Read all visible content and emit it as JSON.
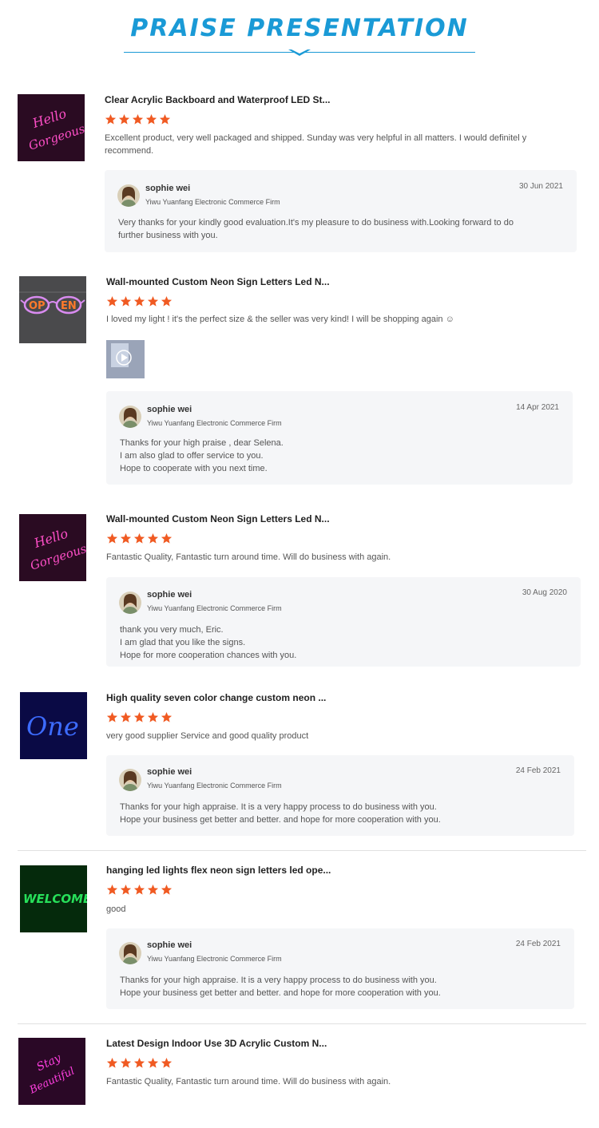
{
  "header": {
    "title": "PRAISE PRESENTATION"
  },
  "colors": {
    "accent": "#1a9ad6",
    "star": "#f05a22",
    "reply_bg": "#f5f6f8"
  },
  "reviews": [
    {
      "product_title": "Clear Acrylic Backboard and Waterproof LED St...",
      "rating": 5,
      "text": "Excellent product, very well packaged and shipped. Sunday was very helpful in all matters. I would definitel y recommend.",
      "reply": {
        "name": "sophie wei",
        "firm": "Yiwu Yuanfang Electronic Commerce Firm",
        "date": "30 Jun 2021",
        "lines": [
          "Very thanks for your kindly good evaluation.It's my pleasure to do business with.Looking forward to do",
          "further business with you."
        ]
      }
    },
    {
      "product_title": "Wall-mounted Custom Neon Sign Letters Led N...",
      "rating": 5,
      "text": "I loved my light ! it's the perfect size & the seller was very kind! I will be shopping again ☺",
      "reply": {
        "name": "sophie wei",
        "firm": "Yiwu Yuanfang Electronic Commerce Firm",
        "date": "14 Apr 2021",
        "lines": [
          "Thanks for your high praise , dear Selena.",
          "I am also glad to offer service to you.",
          "Hope to cooperate with you next time."
        ]
      }
    },
    {
      "product_title": "Wall-mounted Custom Neon Sign Letters Led N...",
      "rating": 5,
      "text": "Fantastic Quality, Fantastic turn around time. Will do business with again.",
      "reply": {
        "name": "sophie wei",
        "firm": "Yiwu Yuanfang Electronic Commerce Firm",
        "date": "30 Aug 2020",
        "lines": [
          "thank you very much, Eric.",
          "I am glad that you like the signs.",
          "Hope for more cooperation chances with you."
        ]
      }
    },
    {
      "product_title": "High quality seven color change custom neon ...",
      "rating": 5,
      "text": "very good supplier Service and good quality product",
      "reply": {
        "name": "sophie wei",
        "firm": "Yiwu Yuanfang Electronic Commerce Firm",
        "date": "24 Feb 2021",
        "lines": [
          "Thanks for your high appraise. It is a very happy process to do business with you.",
          "Hope your business get better and better. and hope for more cooperation with you."
        ]
      }
    },
    {
      "product_title": "hanging led lights flex neon sign letters led ope...",
      "rating": 5,
      "text": "good",
      "reply": {
        "name": "sophie wei",
        "firm": "Yiwu Yuanfang Electronic Commerce Firm",
        "date": "24 Feb 2021",
        "lines": [
          "Thanks for your high appraise. It is a very happy process to do business with you.",
          "Hope your business get better and better. and hope for more cooperation with you."
        ]
      }
    },
    {
      "product_title": "Latest Design Indoor Use 3D Acrylic Custom N...",
      "rating": 5,
      "text": "Fantastic Quality, Fantastic turn around time. Will do business with again."
    }
  ],
  "thumbnails": [
    {
      "icon": "neon-hello-gorgeous-pink-image",
      "text_lines": [
        "Hello",
        "Gorgeous"
      ]
    },
    {
      "icon": "neon-open-glasses-image",
      "text_lines": [
        "OP",
        "EN"
      ]
    },
    {
      "icon": "neon-hello-gorgeous-pink-image",
      "text_lines": [
        "Hello",
        "Gorgeous"
      ]
    },
    {
      "icon": "neon-one-blue-image",
      "text_lines": [
        "One"
      ]
    },
    {
      "icon": "neon-welcome-green-image",
      "text_lines": [
        "WELCOME"
      ]
    },
    {
      "icon": "neon-stay-beautiful-pink-image",
      "text_lines": [
        "Stay",
        "Beautiful"
      ]
    }
  ]
}
